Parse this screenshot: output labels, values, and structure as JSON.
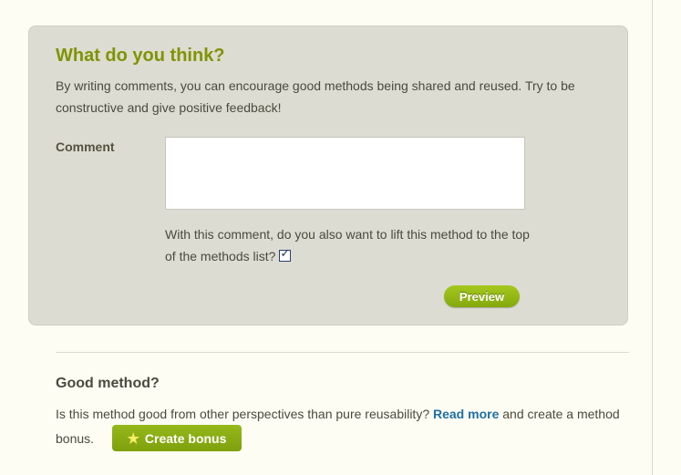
{
  "comment_form": {
    "title": "What do you think?",
    "intro": "By writing comments, you can encourage good methods being shared and reused. Try to be constructive and give positive feedback!",
    "comment_label": "Comment",
    "comment_value": "",
    "lift_question": "With this comment, do you also want to lift this method to the top of the methods list?",
    "lift_checked": true,
    "preview_label": "Preview"
  },
  "good_method": {
    "title": "Good method?",
    "text_before": "Is this method good from other perspectives than pure reusability?",
    "read_more_label": "Read more",
    "text_after": "and create a method bonus.",
    "create_bonus_label": "Create bonus",
    "bonus_icon": "star-icon"
  },
  "colors": {
    "accent_green": "#7f9400",
    "button_green": "#8fb214",
    "link_blue": "#1f6fa4",
    "panel_bg": "#dddcd2",
    "page_bg": "#fefdf3"
  }
}
